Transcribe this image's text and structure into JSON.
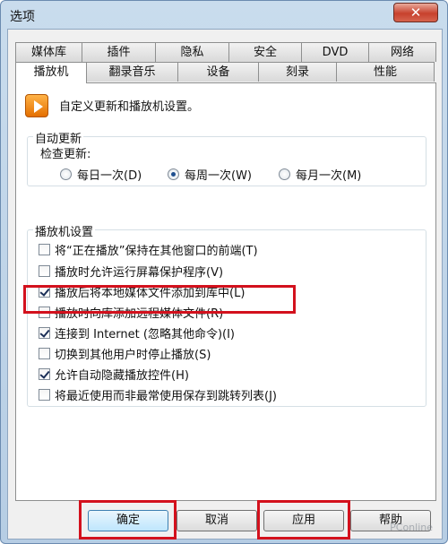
{
  "window": {
    "title": "选项",
    "close_glyph": "✕"
  },
  "tabs_back": [
    "媒体库",
    "插件",
    "隐私",
    "安全",
    "DVD",
    "网络"
  ],
  "tabs_front": [
    "播放机",
    "翻录音乐",
    "设备",
    "刻录",
    "性能"
  ],
  "active_tab": "播放机",
  "header": {
    "icon": "player-icon",
    "text": "自定义更新和播放机设置。"
  },
  "auto_update": {
    "title": "自动更新",
    "check_label": "检查更新:",
    "options": [
      {
        "label": "每日一次(D)",
        "selected": false
      },
      {
        "label": "每周一次(W)",
        "selected": true
      },
      {
        "label": "每月一次(M)",
        "selected": false
      }
    ]
  },
  "player_settings": {
    "title": "播放机设置",
    "items": [
      {
        "label": "将“正在播放”保持在其他窗口的前端(T)",
        "checked": false
      },
      {
        "label": "播放时允许运行屏幕保护程序(V)",
        "checked": false
      },
      {
        "label": "播放后将本地媒体文件添加到库中(L)",
        "checked": true
      },
      {
        "label": "播放时向库添加远程媒体文件(R)",
        "checked": false
      },
      {
        "label": "连接到 Internet (忽略其他命令)(I)",
        "checked": true
      },
      {
        "label": "切换到其他用户时停止播放(S)",
        "checked": false
      },
      {
        "label": "允许自动隐藏播放控件(H)",
        "checked": true
      },
      {
        "label": "将最近使用而非最常使用保存到跳转列表(J)",
        "checked": false
      }
    ]
  },
  "buttons": {
    "ok": "确定",
    "cancel": "取消",
    "apply": "应用",
    "help": "帮助"
  },
  "watermark": "PConline",
  "colors": {
    "highlight": "#d3111d",
    "close": "#c7412d"
  }
}
